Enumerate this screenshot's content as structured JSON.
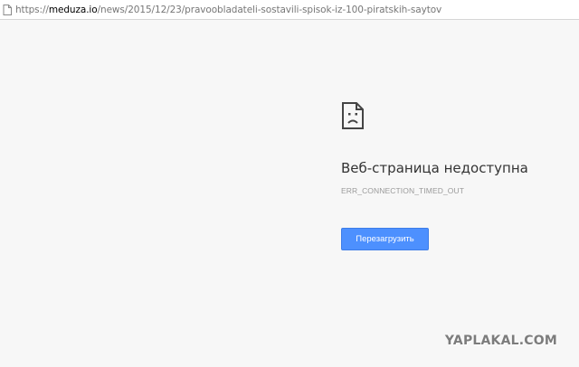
{
  "address_bar": {
    "scheme": "https://",
    "host": "meduza.io",
    "path": "/news/2015/12/23/pravoobladateli-sostavili-spisok-iz-100-piratskih-saytov",
    "icon": "page-icon"
  },
  "error": {
    "icon": "sad-document-icon",
    "title": "Веб-страница недоступна",
    "code": "ERR_CONNECTION_TIMED_OUT",
    "reload_label": "Перезагрузить"
  },
  "watermark": {
    "text": "YAPLAKAL.COM"
  },
  "colors": {
    "background": "#f7f7f7",
    "button": "#4d90fe",
    "title_text": "#333333",
    "code_text": "#9a9a9a"
  }
}
